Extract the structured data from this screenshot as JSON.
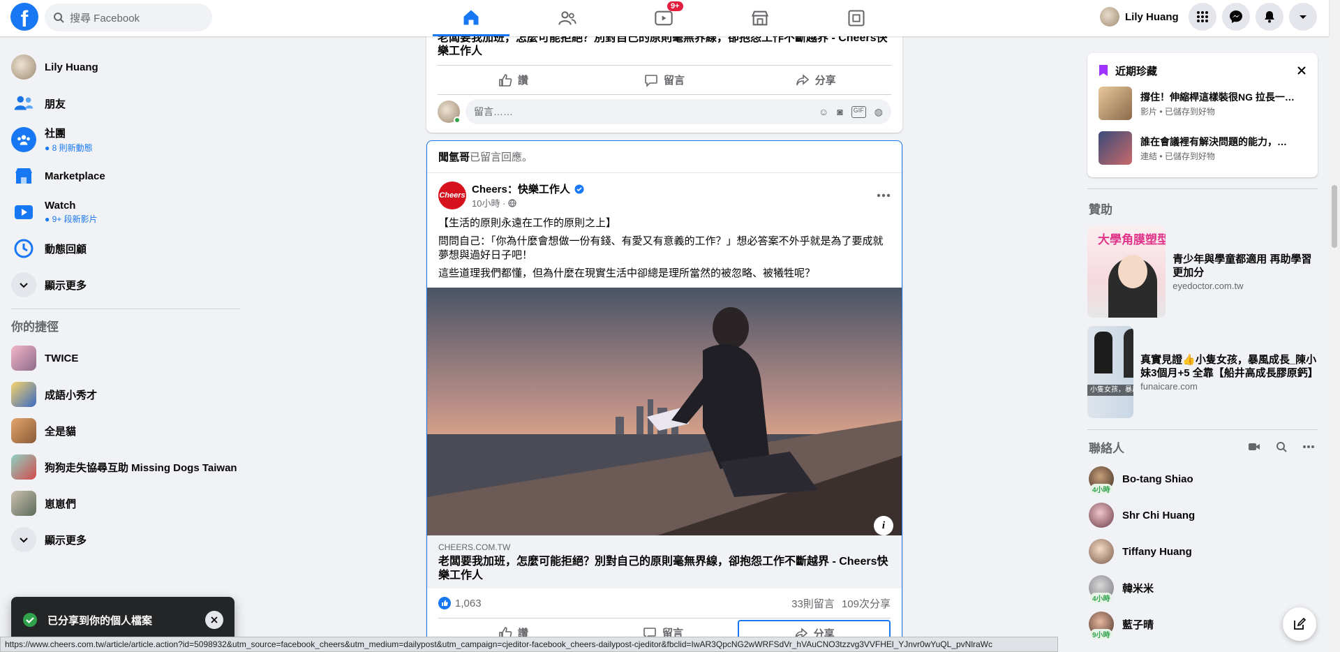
{
  "topbar": {
    "search_placeholder": "搜尋 Facebook",
    "watch_badge": "9+",
    "user_name": "Lily Huang"
  },
  "left_nav": {
    "profile": "Lily Huang",
    "friends": "朋友",
    "groups": "社團",
    "groups_sub": "8 則新動態",
    "marketplace": "Marketplace",
    "watch": "Watch",
    "watch_sub": "9+ 段新影片",
    "memories": "動態回顧",
    "show_more_1": "顯示更多",
    "shortcuts_title": "你的捷徑",
    "shortcuts": [
      "TWICE",
      "成語小秀才",
      "全是貓",
      "狗狗走失協尋互助 Missing Dogs Taiwan",
      "崽崽們"
    ],
    "show_more_2": "顯示更多"
  },
  "feed": {
    "prev_post_title": "老闆要我加班，怎麼可能拒絕？別對自己的原則毫無界線，卻抱怨工作不斷越界 - Cheers快樂工作人",
    "like_label": "讚",
    "comment_label": "留言",
    "share_label": "分享",
    "comment_placeholder": "留言……",
    "context_actor": "聞氫哥",
    "context_text": "已留言回應。",
    "page_name": "Cheers：快樂工作人",
    "post_time": "10小時 ·",
    "text_line1": "【生活的原則永遠在工作的原則之上】",
    "text_line2": "問問自己：「你為什麼會想做一份有錢、有愛又有意義的工作？」想必答案不外乎就是為了要成就夢想與過好日子吧！",
    "text_line3": "這些道理我們都懂，但為什麼在現實生活中卻總是理所當然的被忽略、被犧牲呢？",
    "link_domain": "CHEERS.COM.TW",
    "link_title": "老闆要我加班，怎麼可能拒絕？別對自己的原則毫無界線，卻抱怨工作不斷越界 - Cheers快樂工作人",
    "reactions": "1,063",
    "comments_count": "33則留言",
    "shares_count": "109次分享",
    "image_info": "i"
  },
  "right": {
    "saved_title": "近期珍藏",
    "saved_items": [
      {
        "title": "撐住！伸縮桿這樣裝很NG 拉長一…",
        "meta": "影片 • 已儲存到好物"
      },
      {
        "title": "誰在會議裡有解決問題的能力，…",
        "meta": "連結 • 已儲存到好物"
      }
    ],
    "sponsored_title": "贊助",
    "ads": [
      {
        "img_text": "大學角膜塑型",
        "title": "青少年與學童都適用 再助學習更加分",
        "domain": "eyedoctor.com.tw"
      },
      {
        "img_text": "小隻女孩，暴風成長！",
        "title": "真實見證👍小隻女孩，暴風成長_陳小妹3個月+5 全靠【船井高成長膠原鈣】",
        "domain": "funaicare.com"
      }
    ],
    "contacts_title": "聯絡人",
    "contacts": [
      {
        "name": "Bo-tang Shiao",
        "time": "4小時"
      },
      {
        "name": "Shr Chi Huang",
        "time": ""
      },
      {
        "name": "Tiffany Huang",
        "time": ""
      },
      {
        "name": "韓米米",
        "time": "4小時"
      },
      {
        "name": "藍子晴",
        "time": "9小時"
      }
    ]
  },
  "toast": {
    "text": "已分享到你的個人檔案"
  },
  "statusbar": {
    "url": "https://www.cheers.com.tw/article/article.action?id=5098932&utm_source=facebook_cheers&utm_medium=dailypost&utm_campaign=cjeditor-facebook_cheers-dailypost-cjeditor&fbclid=IwAR3QpcNG2wWRFSdVr_hVAuCNO3tzzvg3VVFHEl_YJnvr0wYuQL_pvNlraWc"
  }
}
